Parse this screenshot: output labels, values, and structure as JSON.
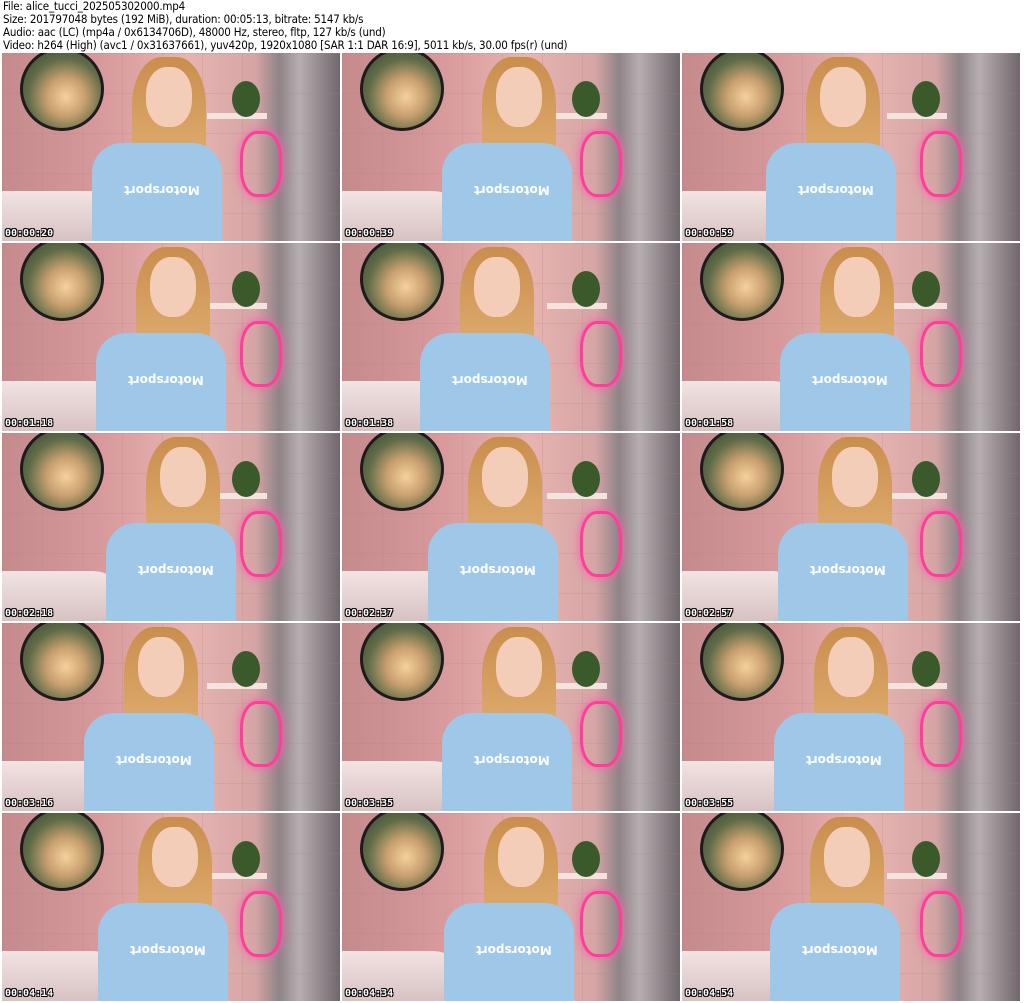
{
  "header": {
    "file": "File: alice_tucci_202505302000.mp4",
    "size": "Size: 201797048 bytes (192 MiB), duration: 00:05:13, bitrate: 5147 kb/s",
    "audio": "Audio: aac (LC) (mp4a / 0x6134706D), 48000 Hz, stereo, fltp, 127 kb/s (und)",
    "video": "Video: h264 (High) (avc1 / 0x31637661), yuv420p, 1920x1080 [SAR 1:1 DAR 16:9], 5011 kb/s, 30.00 fps(r) (und)"
  },
  "shirt_text": "Motorsport",
  "thumbnails": [
    {
      "timestamp": "00:00:20"
    },
    {
      "timestamp": "00:00:39"
    },
    {
      "timestamp": "00:00:59"
    },
    {
      "timestamp": "00:01:18"
    },
    {
      "timestamp": "00:01:38"
    },
    {
      "timestamp": "00:01:58"
    },
    {
      "timestamp": "00:02:18"
    },
    {
      "timestamp": "00:02:37"
    },
    {
      "timestamp": "00:02:57"
    },
    {
      "timestamp": "00:03:16"
    },
    {
      "timestamp": "00:03:35"
    },
    {
      "timestamp": "00:03:55"
    },
    {
      "timestamp": "00:04:14"
    },
    {
      "timestamp": "00:04:34"
    },
    {
      "timestamp": "00:04:54"
    }
  ]
}
